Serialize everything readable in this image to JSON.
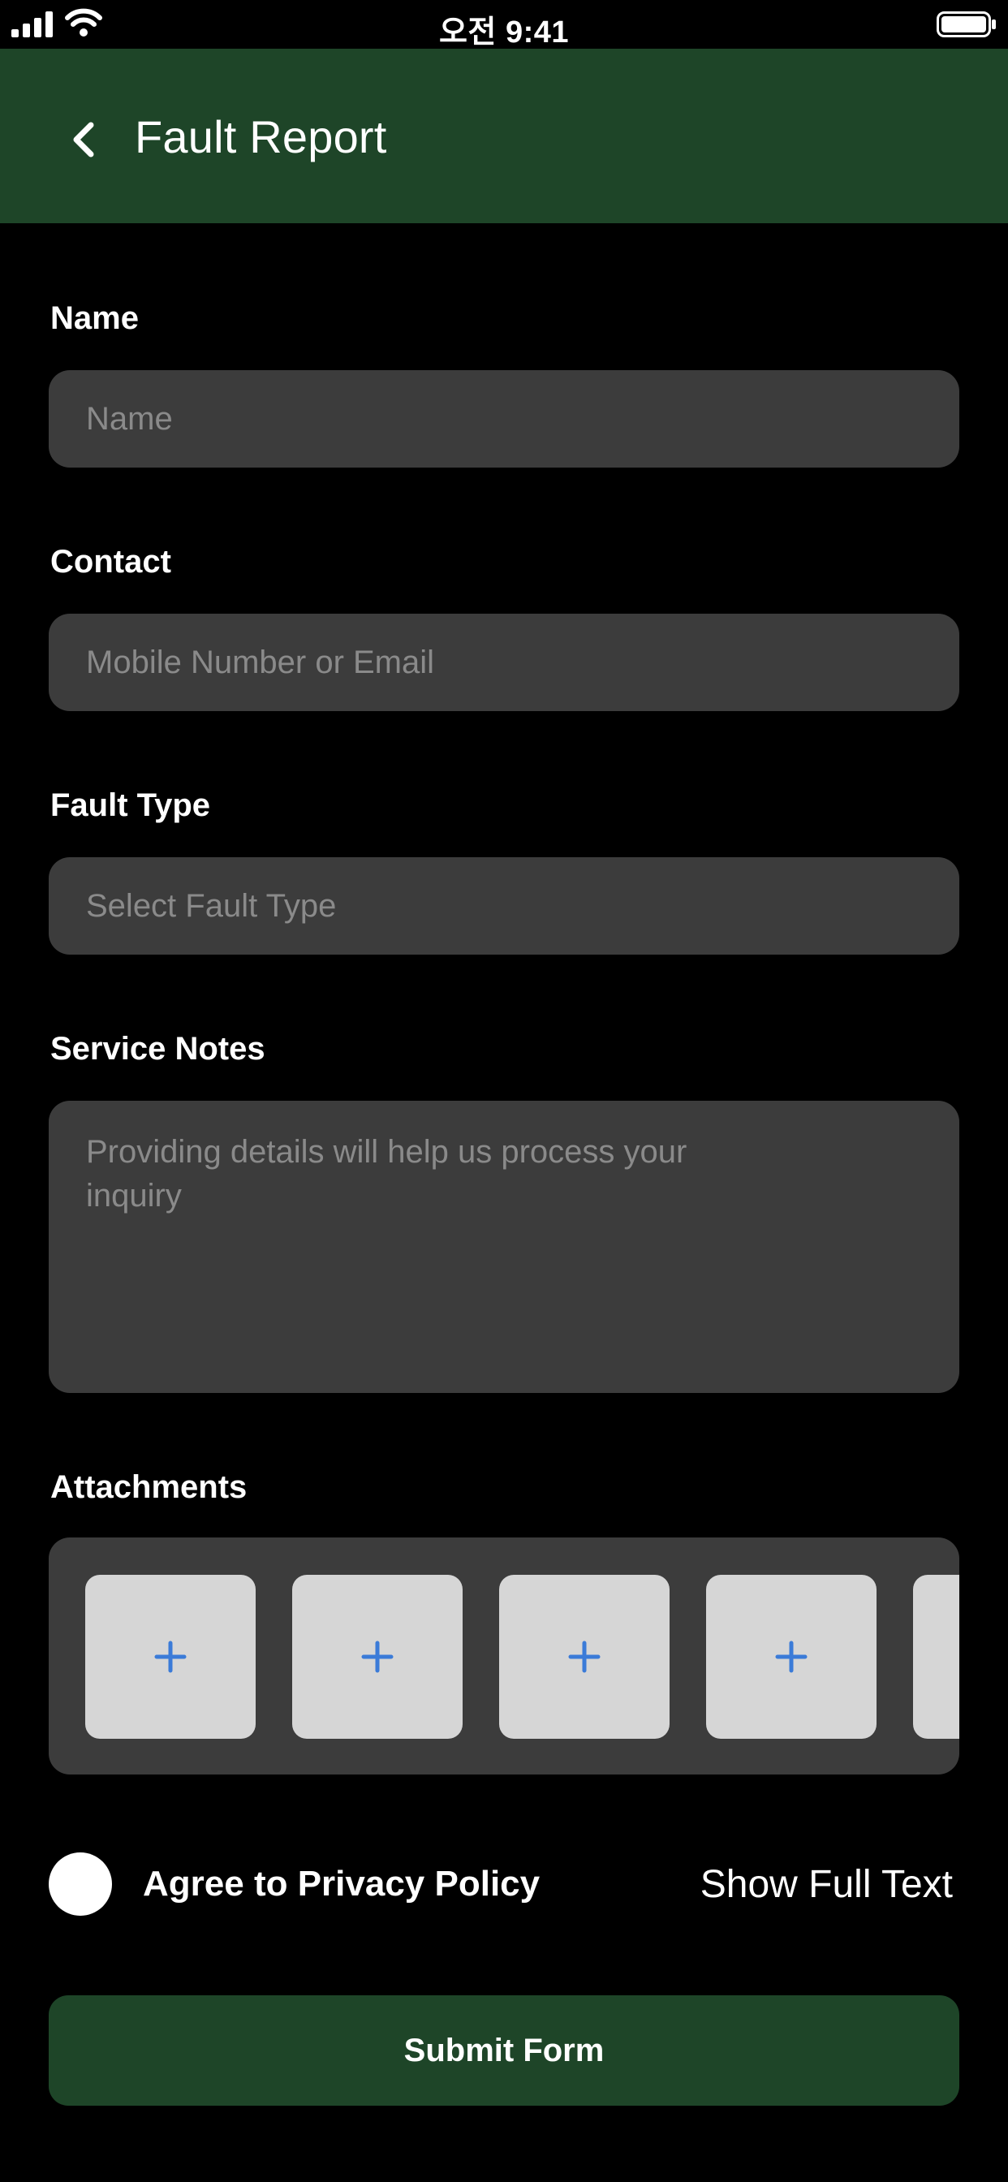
{
  "status_bar": {
    "time": "오전 9:41"
  },
  "header": {
    "title": "Fault Report",
    "back_icon": "chevron-left-icon"
  },
  "form": {
    "name": {
      "label": "Name",
      "placeholder": "Name"
    },
    "contact": {
      "label": "Contact",
      "placeholder": "Mobile Number or Email"
    },
    "fault_type": {
      "label": "Fault Type",
      "placeholder": "Select Fault Type"
    },
    "service_notes": {
      "label": "Service Notes",
      "placeholder": "Providing details will help us process your inquiry"
    },
    "attachments": {
      "label": "Attachments",
      "add_icon": "plus-icon",
      "accent_color": "#3b7bd8"
    }
  },
  "privacy": {
    "label": "Agree to Privacy Policy",
    "link": "Show Full Text"
  },
  "submit": {
    "label": "Submit Form"
  },
  "colors": {
    "brand": "#1e4528",
    "field_bg": "#3c3c3c",
    "background": "#000000"
  }
}
